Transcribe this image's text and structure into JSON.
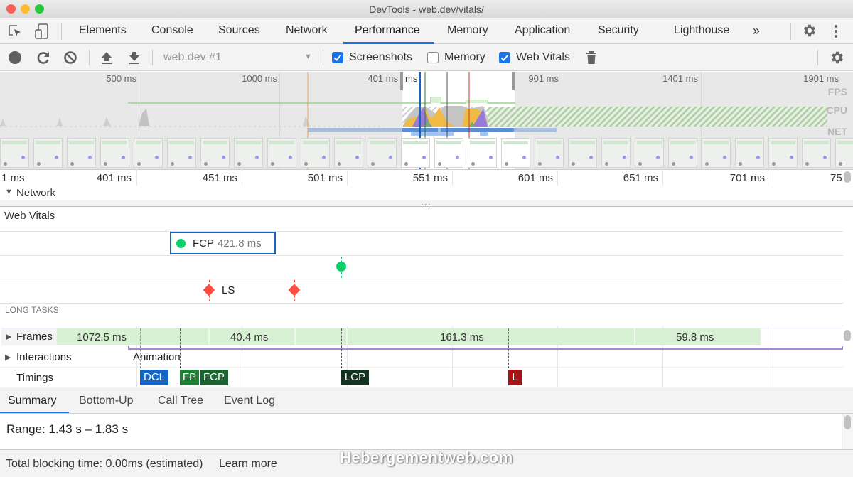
{
  "window": {
    "title": "DevTools - web.dev/vitals/",
    "controls": [
      {
        "name": "close",
        "color": "#fc5f57"
      },
      {
        "name": "minimize",
        "color": "#fdbc2e"
      },
      {
        "name": "maximize",
        "color": "#28c840"
      }
    ]
  },
  "main_tabs": [
    {
      "label": "Elements"
    },
    {
      "label": "Console"
    },
    {
      "label": "Sources"
    },
    {
      "label": "Network"
    },
    {
      "label": "Performance",
      "active": true
    },
    {
      "label": "Memory"
    },
    {
      "label": "Application"
    },
    {
      "label": "Security"
    },
    {
      "label": "Lighthouse"
    }
  ],
  "more_tabs_glyph": "»",
  "toolbar": {
    "profile_select": "web.dev #1",
    "checkboxes": [
      {
        "label": "Screenshots",
        "checked": true
      },
      {
        "label": "Memory",
        "checked": false
      },
      {
        "label": "Web Vitals",
        "checked": true
      }
    ]
  },
  "overview": {
    "ticks": [
      "500 ms",
      "1000 ms",
      "401 ms",
      "901 ms",
      "1401 ms",
      "1901 ms"
    ],
    "lane_labels": [
      "FPS",
      "CPU",
      "NET"
    ]
  },
  "ruler": {
    "ticks": [
      "1 ms",
      "401 ms",
      "451 ms",
      "501 ms",
      "551 ms",
      "601 ms",
      "651 ms",
      "701 ms",
      "75"
    ]
  },
  "network_track": {
    "label": "Network",
    "expanded": true
  },
  "web_vitals": {
    "title": "Web Vitals",
    "fcp_tooltip": {
      "metric": "FCP",
      "value": "421.8 ms"
    },
    "ls_label": "LS",
    "long_tasks_label": "LONG TASKS",
    "colors": {
      "good": "#0cce6b",
      "poor": "#ff4e42",
      "highlight": "#1a63c6"
    }
  },
  "tracks": {
    "frames": {
      "label": "Frames",
      "durations": [
        "1072.5 ms",
        "40.4 ms",
        "161.3 ms",
        "59.8 ms"
      ]
    },
    "interactions": {
      "label": "Interactions",
      "event": "Animation"
    },
    "timings": {
      "label": "Timings",
      "markers": [
        {
          "label": "DCL",
          "color": "#1565c0"
        },
        {
          "label": "FP",
          "color": "#1e7e34"
        },
        {
          "label": "FCP",
          "color": "#1b6330"
        },
        {
          "label": "LCP",
          "color": "#133220"
        },
        {
          "label": "L",
          "color": "#a51515"
        }
      ]
    }
  },
  "bottom_tabs": [
    {
      "label": "Summary",
      "active": true
    },
    {
      "label": "Bottom-Up"
    },
    {
      "label": "Call Tree"
    },
    {
      "label": "Event Log"
    }
  ],
  "summary": {
    "range": "Range: 1.43 s – 1.83 s",
    "total_blocking": "Total blocking time: 0.00ms (estimated)",
    "learn_more": "Learn more"
  },
  "watermark": "Hebergementweb.com"
}
